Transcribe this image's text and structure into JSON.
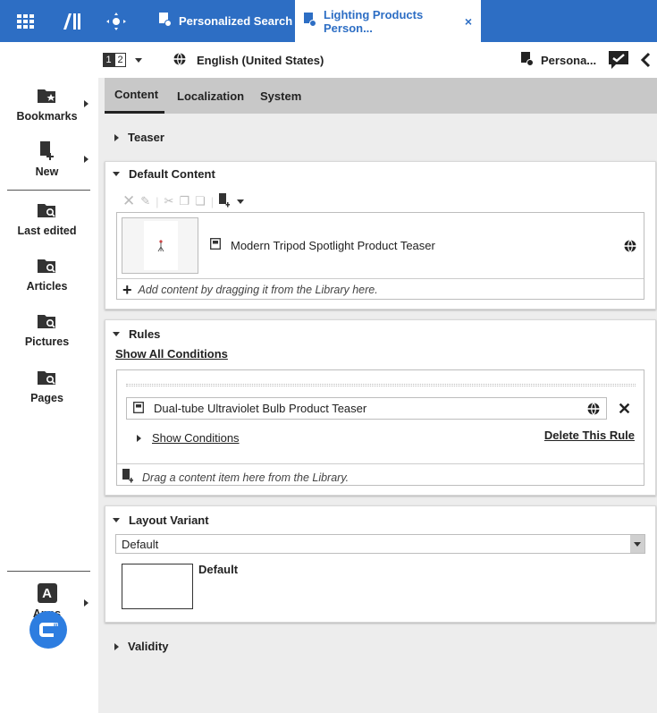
{
  "topbar": {
    "tabs": [
      {
        "label": "Personalized Search"
      },
      {
        "label": "Lighting Products Person...",
        "close": "×"
      }
    ]
  },
  "sidebar": {
    "items": [
      {
        "label": "Bookmarks"
      },
      {
        "label": "New"
      },
      {
        "label": "Last edited"
      },
      {
        "label": "Articles"
      },
      {
        "label": "Pictures"
      },
      {
        "label": "Pages"
      },
      {
        "label": "Apps"
      }
    ],
    "apps_letter": "A"
  },
  "header": {
    "version": [
      "1",
      "2"
    ],
    "locale": "English (United States)",
    "doc_type": "Persona..."
  },
  "content_tabs": [
    "Content",
    "Localization",
    "System"
  ],
  "sections": {
    "teaser": "Teaser",
    "default_content": {
      "title": "Default Content",
      "item_title": "Modern Tripod Spotlight Product Teaser",
      "drop_hint": "Add content by dragging it from the Library here."
    },
    "rules": {
      "title": "Rules",
      "show_all": "Show All Conditions",
      "rule_item": "Dual-tube Ultraviolet Bulb Product Teaser",
      "show_conditions": "Show Conditions",
      "delete_rule": "Delete This Rule",
      "drop_hint": "Drag a content item here from the Library."
    },
    "layout_variant": {
      "title": "Layout Variant",
      "selected": "Default",
      "preview_label": "Default"
    },
    "validity": "Validity"
  },
  "colors": {
    "topbar": "#2d6ec4",
    "logo": "#2d7de0"
  }
}
